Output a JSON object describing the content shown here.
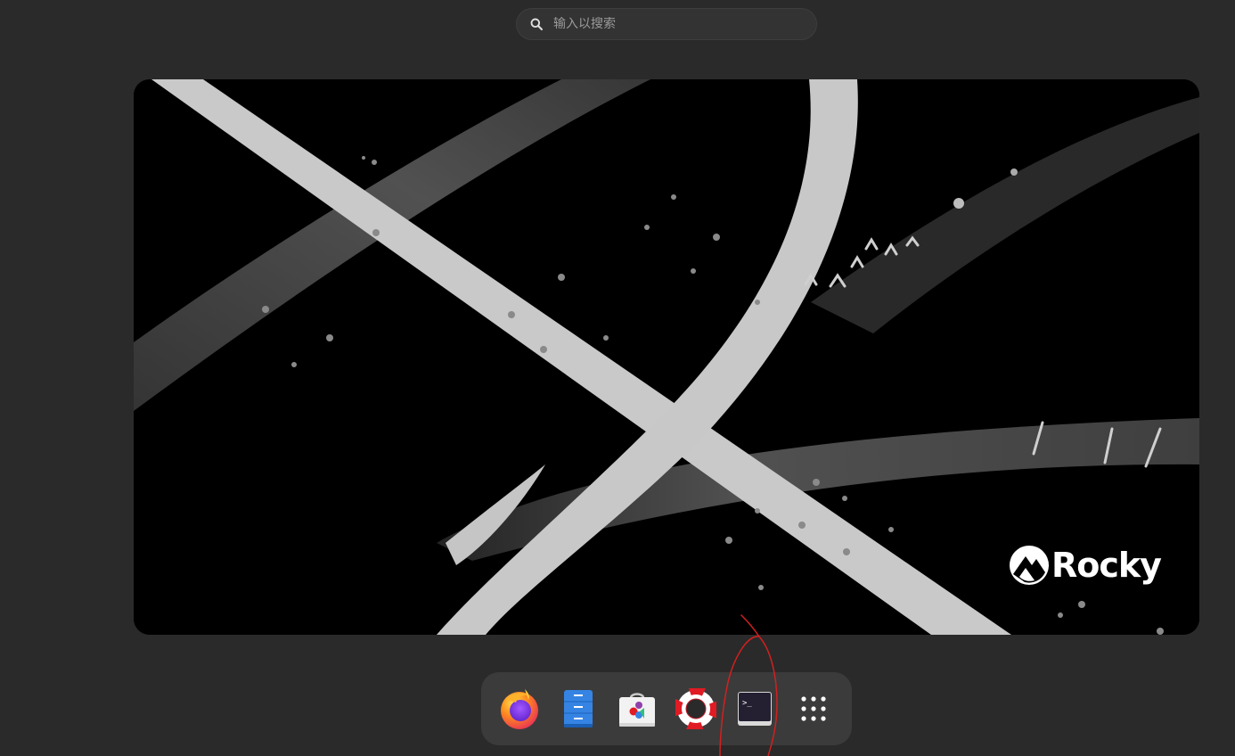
{
  "search": {
    "placeholder": "输入以搜索"
  },
  "workspace": {
    "wallpaper_brand": "Rocky"
  },
  "dock": {
    "items": [
      {
        "name": "firefox",
        "icon": "firefox-icon"
      },
      {
        "name": "files",
        "icon": "file-cabinet-icon"
      },
      {
        "name": "software",
        "icon": "shopping-bag-icon"
      },
      {
        "name": "help",
        "icon": "lifebuoy-icon"
      },
      {
        "name": "terminal",
        "icon": "terminal-icon",
        "terminal_prompt": ">_"
      },
      {
        "name": "show-apps",
        "icon": "app-grid-icon"
      }
    ]
  },
  "annotation": {
    "color": "#d22020",
    "target": "terminal"
  }
}
